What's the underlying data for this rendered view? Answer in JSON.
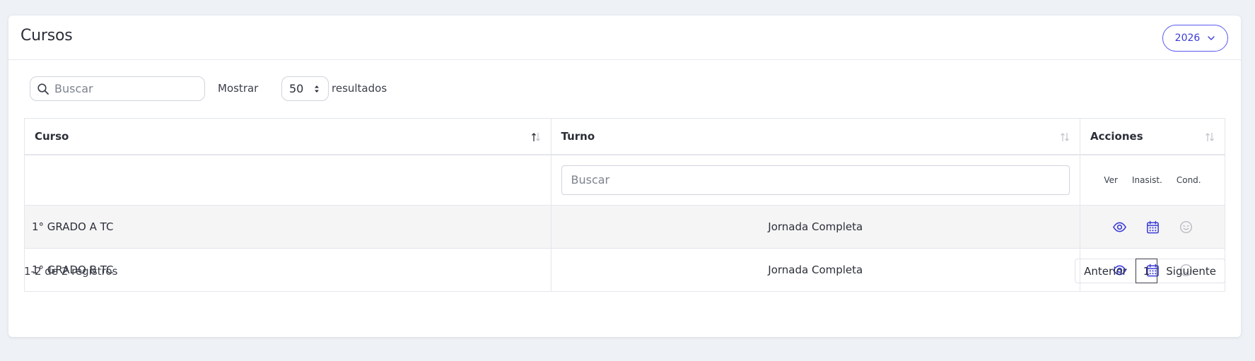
{
  "header": {
    "title": "Cursos",
    "year": "2026"
  },
  "toolbar": {
    "search_placeholder": "Buscar",
    "show_label": "Mostrar",
    "page_size": "50",
    "results_label": "resultados"
  },
  "table": {
    "columns": [
      "Curso",
      "Turno",
      "Acciones"
    ],
    "turno_filter_placeholder": "Buscar",
    "action_labels": [
      "Ver",
      "Inasist.",
      "Cond."
    ],
    "rows": [
      {
        "curso": "1° GRADO A TC",
        "turno": "Jornada Completa"
      },
      {
        "curso": "1° GRADO B TC",
        "turno": "Jornada Completa"
      }
    ]
  },
  "footer": {
    "info": "1-2 de 2 registros",
    "prev": "Anterior",
    "current_page": "1",
    "next": "Siguiente"
  },
  "icons": {
    "view": "eye-icon",
    "absences": "calendar-icon",
    "conduct": "smiley-icon",
    "search": "search-icon",
    "year_dropdown": "chevron-down-icon"
  },
  "colors": {
    "accent": "#3b3bd9",
    "muted_icon": "#b9bcc3",
    "background": "#eef1f5",
    "row_stripe": "#f5f5f6"
  }
}
